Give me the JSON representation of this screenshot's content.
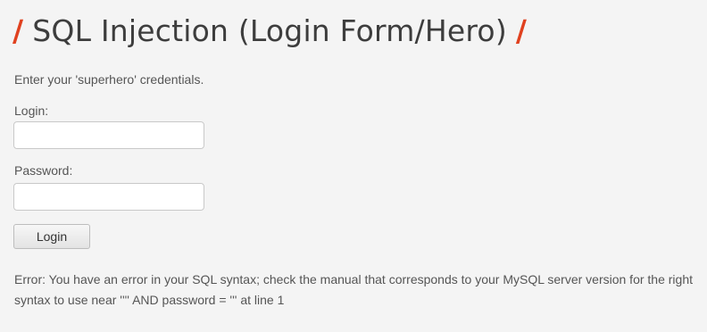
{
  "header": {
    "title": "SQL Injection (Login Form/Hero)",
    "slash_left": "/",
    "slash_right": "/",
    "accent_color": "#e0411f"
  },
  "form": {
    "intro": "Enter your 'superhero' credentials.",
    "login_label": "Login:",
    "login_value": "",
    "password_label": "Password:",
    "password_value": "",
    "submit_label": "Login"
  },
  "message": {
    "error": "Error: You have an error in your SQL syntax; check the manual that corresponds to your MySQL server version for the right syntax to use near '''' AND password = ''' at line 1"
  }
}
